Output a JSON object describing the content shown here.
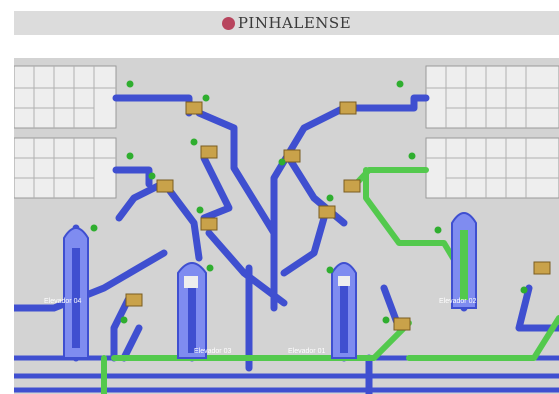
{
  "header": {
    "brand": "PINHALENSE"
  },
  "colors": {
    "pipe_blue": "#3f4fd0",
    "pipe_light": "#7f8cf0",
    "pipe_green": "#53c94d",
    "valve": "#c9a24a",
    "status_ok": "#2fae2f",
    "plant_bg": "#d3d3d3"
  },
  "elevators": [
    {
      "id": "e04",
      "label": "Elevador 04"
    },
    {
      "id": "e03",
      "label": "Elevador 03"
    },
    {
      "id": "e01",
      "label": "Elevador 01"
    },
    {
      "id": "e02",
      "label": "Elevador 02"
    }
  ],
  "status_tag": "A"
}
